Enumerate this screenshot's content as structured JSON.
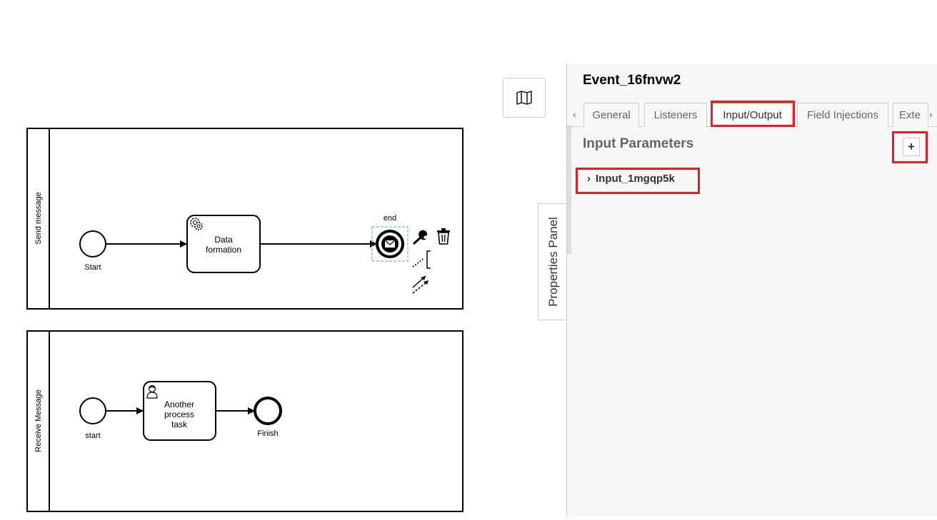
{
  "diagram": {
    "lanes": [
      {
        "label": "Send message"
      },
      {
        "label": "Receive Message"
      }
    ],
    "events": {
      "start1": "Start",
      "end1": "end",
      "start2": "start",
      "end2": "Finish"
    },
    "tasks": [
      {
        "lines": [
          "Data",
          "formation"
        ]
      },
      {
        "lines": [
          "Another",
          "process",
          "task"
        ]
      }
    ]
  },
  "properties_panel": {
    "toggle_label": "Properties Panel",
    "element_id": "Event_16fnvw2",
    "tabs": [
      {
        "label": "General"
      },
      {
        "label": "Listeners"
      },
      {
        "label": "Input/Output"
      },
      {
        "label": "Field Injections"
      },
      {
        "label": "Exte"
      }
    ],
    "active_tab": "Input/Output",
    "section_title": "Input Parameters",
    "add_label": "+",
    "parameters": [
      {
        "name": "Input_1mgqp5k"
      }
    ]
  },
  "icons": {
    "minimap": "map-icon",
    "tab_prev": "chevron-left-icon",
    "tab_next": "chevron-right-icon",
    "expand": "chevron-right-icon",
    "task1": "gear-icon",
    "task2": "user-icon",
    "end_event": "envelope-icon"
  },
  "colors": {
    "highlight": "#e21d24",
    "active_tab_accent": "#52b415",
    "selection": "#4aa3df"
  }
}
